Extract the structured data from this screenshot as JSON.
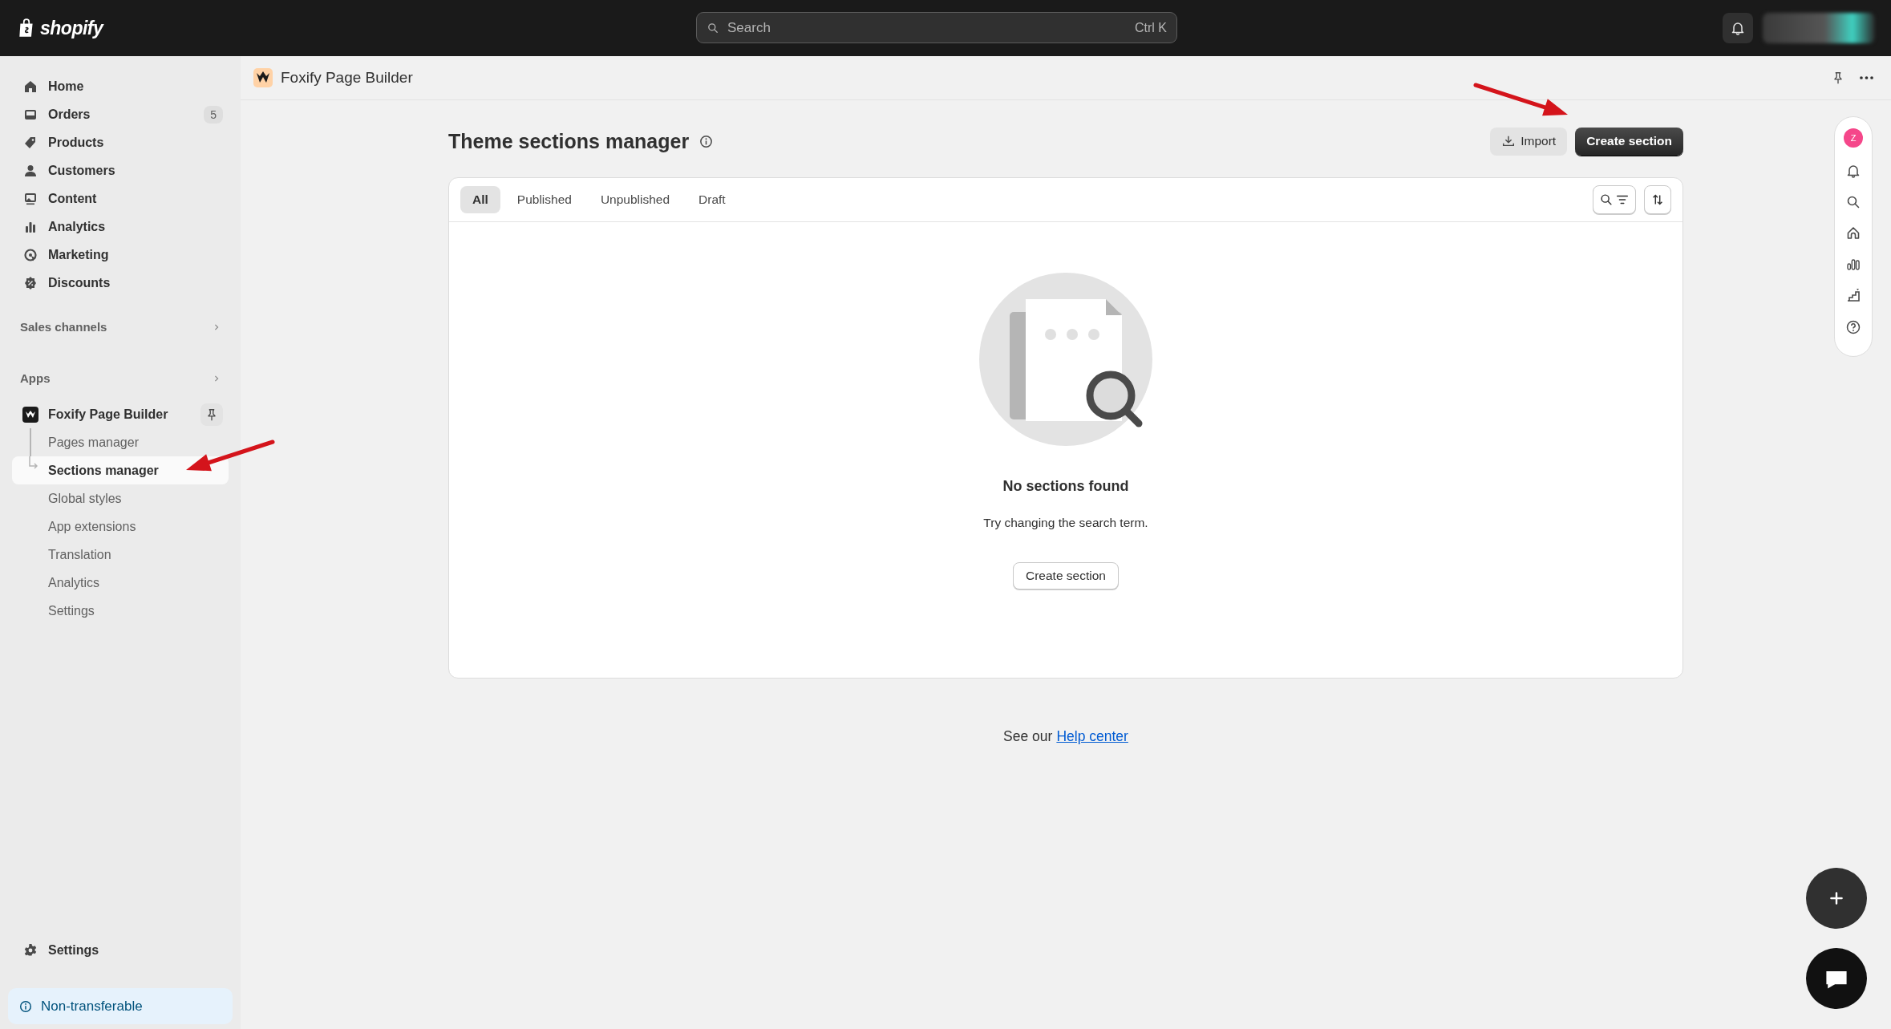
{
  "top_bar": {
    "logo_text": "shopify",
    "search": {
      "placeholder": "Search",
      "shortcut": "Ctrl K"
    }
  },
  "sidebar": {
    "items": [
      {
        "label": "Home"
      },
      {
        "label": "Orders",
        "badge": "5"
      },
      {
        "label": "Products"
      },
      {
        "label": "Customers"
      },
      {
        "label": "Content"
      },
      {
        "label": "Analytics"
      },
      {
        "label": "Marketing"
      },
      {
        "label": "Discounts"
      }
    ],
    "sections": [
      {
        "label": "Sales channels"
      },
      {
        "label": "Apps"
      }
    ],
    "app": {
      "name": "Foxify Page Builder",
      "subitems": [
        {
          "label": "Pages manager",
          "selected": false
        },
        {
          "label": "Sections manager",
          "selected": true
        },
        {
          "label": "Global styles",
          "selected": false
        },
        {
          "label": "App extensions",
          "selected": false
        },
        {
          "label": "Translation",
          "selected": false
        },
        {
          "label": "Analytics",
          "selected": false
        },
        {
          "label": "Settings",
          "selected": false
        }
      ]
    },
    "settings": "Settings",
    "notice": "Non-transferable"
  },
  "app_header": {
    "title": "Foxify Page Builder"
  },
  "page": {
    "title": "Theme sections manager",
    "actions": [
      {
        "label": "Import",
        "kind": "secondary"
      },
      {
        "label": "Create section",
        "kind": "primary"
      }
    ]
  },
  "tabs": [
    {
      "label": "All",
      "selected": true
    },
    {
      "label": "Published",
      "selected": false
    },
    {
      "label": "Unpublished",
      "selected": false
    },
    {
      "label": "Draft",
      "selected": false
    }
  ],
  "empty_state": {
    "heading": "No sections found",
    "text": "Try changing the search term.",
    "button": "Create section"
  },
  "footer": {
    "prefix": "See our",
    "link": "Help center"
  },
  "right_rail": {
    "avatar_letter": "Z"
  },
  "annotation_arrows": [
    {
      "kind": "arrow"
    },
    {
      "kind": "arrow"
    }
  ]
}
